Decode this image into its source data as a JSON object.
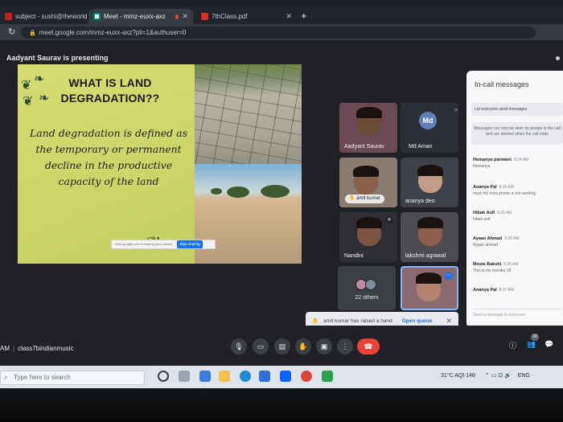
{
  "browser": {
    "tabs": [
      {
        "label": "subject - sushi@theworldsch",
        "active": false
      },
      {
        "label": "Meet - mmz-euxx-axz",
        "active": true
      },
      {
        "label": "7thClass.pdf",
        "active": false
      }
    ],
    "address": "meet.google.com/mmz-euxx-axz?pli=1&authuser=0"
  },
  "meet": {
    "presenting_banner": "Aadyant Saurav is presenting",
    "meeting_code": "class7bindianmusic",
    "time_prefix": "AM",
    "participant_count": "30"
  },
  "slide": {
    "title": "WHAT IS LAND DEGRADATION??",
    "body": "Land degradation is defined as the temporary or permanent decline in the productive capacity of the land",
    "presenting_caption": "meet.google.com is sharing your screen",
    "stop_sharing": "Stop sharing"
  },
  "participants": [
    {
      "name": "Aadyant Saurav",
      "type": "video"
    },
    {
      "name": "Md Aman",
      "type": "avatar",
      "initials": "Md"
    },
    {
      "name": "amit kumar",
      "type": "video",
      "hand_raised": true
    },
    {
      "name": "ananya deo",
      "type": "video"
    },
    {
      "name": "Nandini",
      "type": "video"
    },
    {
      "name": "lakshmi agrawal",
      "type": "video"
    }
  ],
  "others": {
    "label": "22 others"
  },
  "toast": {
    "text": "amit kumar has raised a hand",
    "action": "Open queue"
  },
  "chat": {
    "title": "In-call messages",
    "toggle": "Let everyone send messages",
    "notice": "Messages can only be seen by people in the call and are deleted when the call ends",
    "messages": [
      {
        "sender": "Hemanya panwani",
        "time": "8:24 AM",
        "text": "Hemanya"
      },
      {
        "sender": "Ananya Pal",
        "time": "8:26 AM",
        "text": "mam my mics phone is not working"
      },
      {
        "sender": "Hibah Asif",
        "time": "8:26 AM",
        "text": "hibah asif"
      },
      {
        "sender": "Ayaan Ahmad",
        "time": "8:26 AM",
        "text": "Ayaan ahmad"
      },
      {
        "sender": "Moxia Bakshi",
        "time": "8:26 AM",
        "text": "This is my monitor 28"
      },
      {
        "sender": "Ananya Pal",
        "time": "8:27 AM",
        "text": ""
      }
    ],
    "input_placeholder": "Send a message to everyone"
  },
  "taskbar": {
    "search_placeholder": "Type here to search",
    "weather": "31°C  AQI 148",
    "language": "ENG"
  }
}
